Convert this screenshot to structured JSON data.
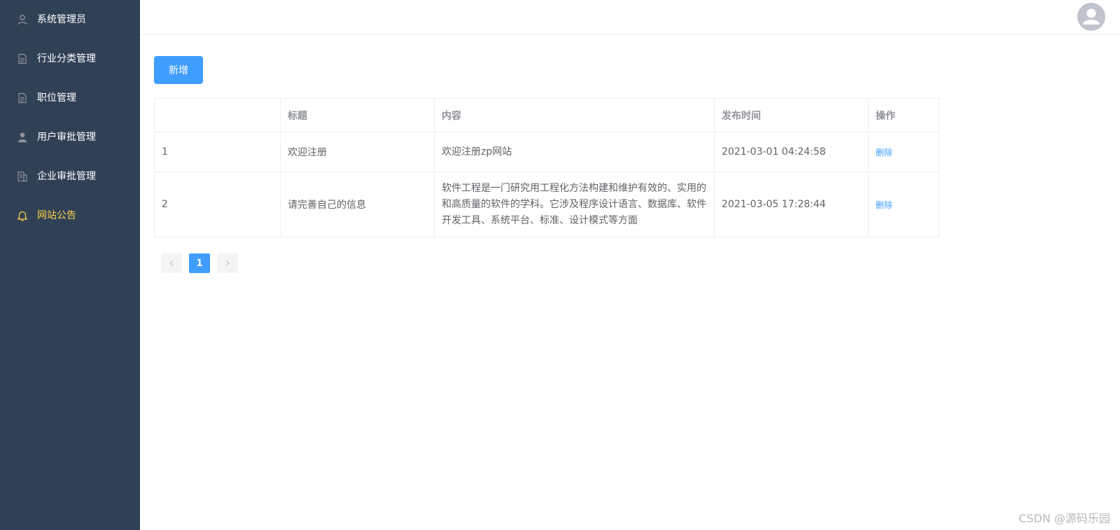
{
  "sidebar": {
    "items": [
      {
        "label": "系统管理员",
        "icon": "user-outline-icon",
        "active": false
      },
      {
        "label": "行业分类管理",
        "icon": "document-icon",
        "active": false
      },
      {
        "label": "职位管理",
        "icon": "document-icon",
        "active": false
      },
      {
        "label": "用户审批管理",
        "icon": "user-solid-icon",
        "active": false
      },
      {
        "label": "企业审批管理",
        "icon": "office-building-icon",
        "active": false
      },
      {
        "label": "网站公告",
        "icon": "bell-icon",
        "active": true
      }
    ]
  },
  "header": {
    "avatar_icon": "avatar-icon"
  },
  "toolbar": {
    "add_label": "新增"
  },
  "table": {
    "columns": [
      "",
      "标题",
      "内容",
      "发布时间",
      "操作"
    ],
    "rows": [
      {
        "index": "1",
        "title": "欢迎注册",
        "content": "欢迎注册zp网站",
        "time": "2021-03-01 04:24:58",
        "action": "删除"
      },
      {
        "index": "2",
        "title": "请完善自己的信息",
        "content": "软件工程是一门研究用工程化方法构建和维护有效的、实用的和高质量的软件的学科。它涉及程序设计语言、数据库、软件开发工具、系统平台、标准、设计模式等方面",
        "time": "2021-03-05 17:28:44",
        "action": "删除"
      }
    ]
  },
  "pagination": {
    "current": "1",
    "prev_icon": "chevron-left-icon",
    "next_icon": "chevron-right-icon"
  },
  "watermark": "CSDN @源码乐园",
  "colors": {
    "sidebar_bg": "#304156",
    "active_menu": "#ffd04b",
    "primary": "#409eff"
  }
}
